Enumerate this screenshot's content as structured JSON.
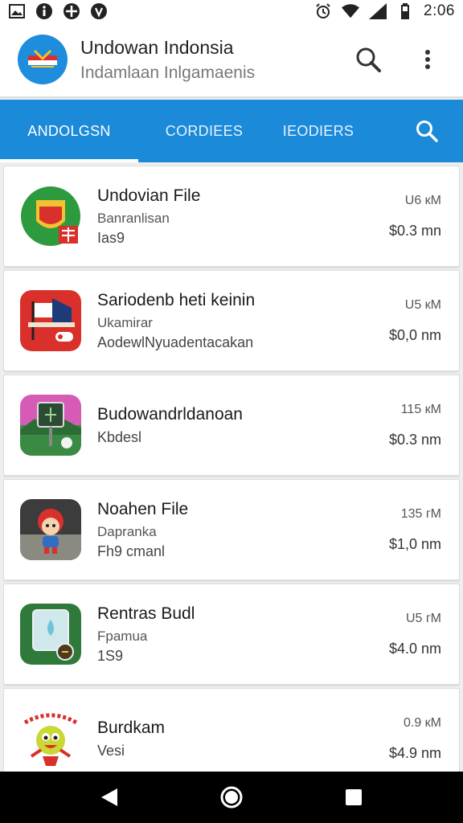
{
  "status_bar": {
    "time": "2:06",
    "left_icons": [
      "image-icon",
      "info-icon",
      "soccer-ball-icon",
      "vine-icon"
    ],
    "right_icons": [
      "alarm-icon",
      "wifi-icon",
      "signal-icon",
      "battery-icon"
    ]
  },
  "app_bar": {
    "title": "Undowan Indonsia",
    "subtitle": "Indamlaan Inlgamaenis",
    "logo_icon": "flag-logo-icon",
    "actions": [
      "search-icon",
      "more-vert-icon"
    ]
  },
  "tabs": {
    "items": [
      {
        "label": "ANDOLGSN",
        "active": true
      },
      {
        "label": "CORDIEES",
        "active": false
      },
      {
        "label": "IEODIERS",
        "active": false
      }
    ],
    "search_icon": "search-icon"
  },
  "accent_color": "#1b8ad8",
  "items": [
    {
      "title": "Undovian File",
      "subtitle": "Banranlisan",
      "meta": "Ias9",
      "size": "U6 кM",
      "price": "$0.3 mn",
      "icon": "shield-crest-icon"
    },
    {
      "title": "Sariodenb heti keinin",
      "subtitle": "Ukamirar",
      "meta": "AodewlNyuadentacakan",
      "size": "U5 кM",
      "price": "$0,0 nm",
      "icon": "flag-stage-icon"
    },
    {
      "title": "Budowandrldanoan",
      "subtitle": "",
      "meta": "Kbdesl",
      "size": "115 кM",
      "price": "$0.3 nm",
      "icon": "landscape-sign-icon"
    },
    {
      "title": "Noahen File",
      "subtitle": "Dapranka",
      "meta": "Fh9 cmanl",
      "size": "135 гM",
      "price": "$1,0 nm",
      "icon": "red-helmet-character-icon"
    },
    {
      "title": "Rentras Budl",
      "subtitle": "Fpamua",
      "meta": "1S9",
      "size": "U5 гM",
      "price": "$4.0 nm",
      "icon": "tablet-drop-icon"
    },
    {
      "title": "Burdkam",
      "subtitle": "",
      "meta": "Vesi",
      "size": "0.9 кM",
      "price": "$4.9 nm",
      "icon": "cartoon-bird-icon"
    }
  ],
  "nav_bar": {
    "buttons": [
      "back-icon",
      "home-icon",
      "recents-icon"
    ]
  }
}
